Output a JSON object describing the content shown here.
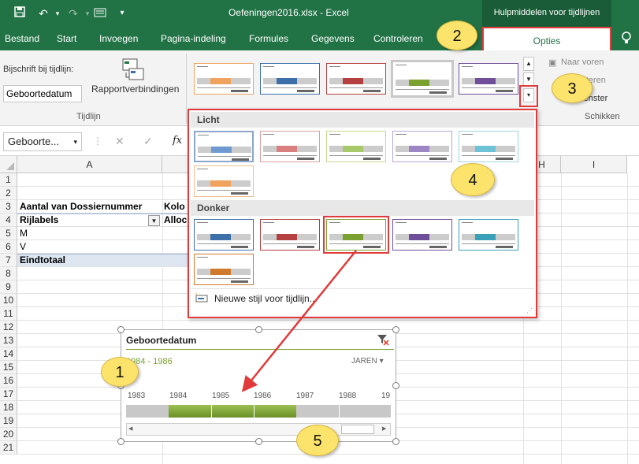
{
  "titlebar": {
    "title": "Oefeningen2016.xlsx - Excel",
    "contextual_group": "Hulpmiddelen voor tijdlijnen"
  },
  "tabs": [
    "Bestand",
    "Start",
    "Invoegen",
    "Pagina-indeling",
    "Formules",
    "Gegevens",
    "Controleren"
  ],
  "active_tab": "Opties",
  "ribbon": {
    "caption_label": "Bijschrift bij tijdlijn:",
    "caption_value": "Geboortedatum",
    "report_connections": "Rapportverbindingen",
    "group_tijdlijn": "Tijdlijn",
    "naar_voren": "Naar voren",
    "achteren": "achteren",
    "venster": "...venster",
    "group_schikken": "Schikken"
  },
  "formulabar": {
    "namebox": "Geboorte...",
    "fx": "fx"
  },
  "grid": {
    "columns": [
      "A",
      "H",
      "I"
    ],
    "rows": [
      "1",
      "2",
      "3",
      "4",
      "5",
      "6",
      "7",
      "8",
      "9",
      "10",
      "11",
      "12",
      "13",
      "14",
      "15",
      "16",
      "17",
      "18",
      "19",
      "20",
      "21"
    ],
    "cells": {
      "a3": "Aantal van Dossiernummer",
      "b3": "Kolo",
      "a4": "Rijlabels",
      "b4": "Alloc",
      "a5": "M",
      "a6": "V",
      "a7": "Eindtotaal"
    }
  },
  "gallery": {
    "section_light": "Licht",
    "section_dark": "Donker",
    "new_style": "Nieuwe stijl voor tijdlijn..."
  },
  "timeline": {
    "title": "Geboortedatum",
    "range": "1984 - 1986",
    "level": "JAREN",
    "years": [
      "1983",
      "1984",
      "1985",
      "1986",
      "1987",
      "1988",
      "19"
    ]
  },
  "callouts": [
    "1",
    "2",
    "3",
    "4",
    "5"
  ],
  "colors": {
    "excel_green": "#217346",
    "timeline_green": "#7aa02f",
    "highlight_red": "#e03a3a",
    "callout_yellow": "#fce36b",
    "style_colors": [
      "#f0a35e",
      "#3d6fa8",
      "#b44040",
      "#7aa02f",
      "#6f4f9a",
      "#3aa0b8"
    ]
  }
}
